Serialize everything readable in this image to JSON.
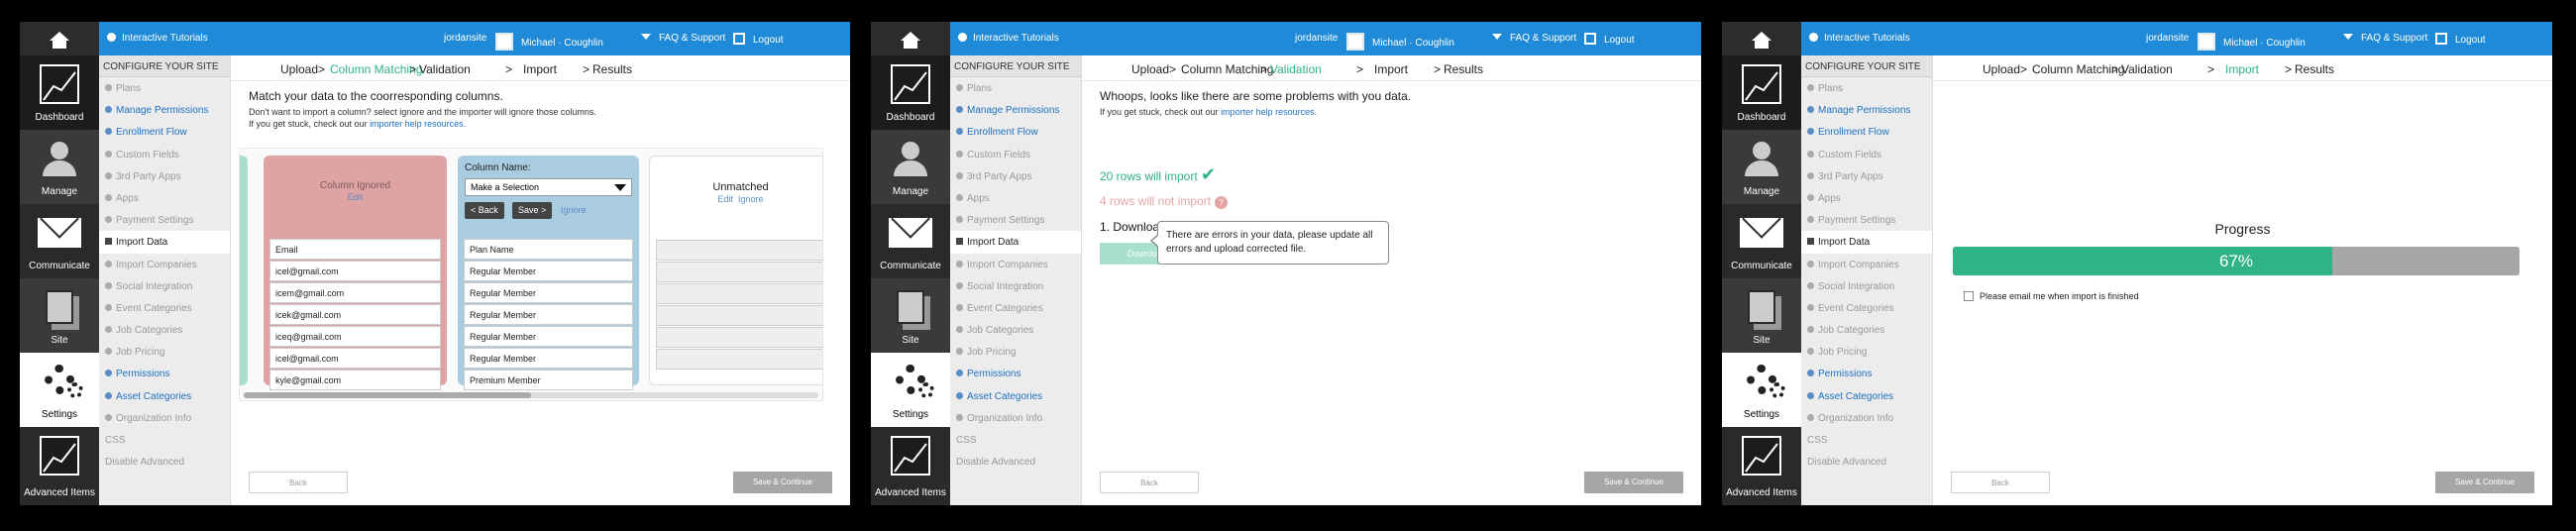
{
  "topbar": {
    "site": "jordansite",
    "user": "Michael · Coughlin",
    "faq": "FAQ & Support",
    "logout": "Logout",
    "info": "Interactive Tutorials"
  },
  "nav": {
    "dashboard": "Dashboard",
    "manage": "Manage",
    "communicate": "Communicate",
    "site": "Site",
    "settings": "Settings",
    "advanced": "Advanced Items"
  },
  "sidebar": {
    "header": "CONFIGURE YOUR SITE",
    "items": [
      "Plans",
      "Manage Permissions",
      "Enrollment Flow",
      "Custom Fields",
      "3rd Party Apps",
      "Apps",
      "Payment Settings",
      "Import Data",
      "Import Companies",
      "Social Integration",
      "Event Categories",
      "Job Categories",
      "Job Pricing",
      "Permissions",
      "Asset Categories",
      "Organization Info",
      "CSS",
      "Disable Advanced"
    ]
  },
  "steps": [
    "Upload",
    "Column Matching",
    "Validation",
    "Import",
    "Results"
  ],
  "sep": ">",
  "footer": {
    "back": "Back",
    "save": "Save & Continue"
  },
  "panel1": {
    "title": "Match your data to the coorresponding columns.",
    "sub1": "Don't want to import a column? select ignore and the importer will ignore those columns.",
    "sub2_pre": "If you get stuck, check out our ",
    "sub2_link": "importer help resources.",
    "ignored_title": "Column Ignored",
    "ignored_edit": "Edit",
    "email_cells": [
      "Email",
      "icel@gmail.com",
      "icem@gmail.com",
      "icek@gmail.com",
      "iceq@gmail.com",
      "icel@gmail.com",
      "kyle@gmail.com"
    ],
    "colname_label": "Column Name:",
    "select_value": "Make a Selection",
    "back_btn": "< Back",
    "save_btn": "Save >",
    "ignore": "Ignore",
    "plan_cells": [
      "Plan Name",
      "Regular Member",
      "Regular Member",
      "Regular Member",
      "Regular Member",
      "Regular Member",
      "Premium Member"
    ],
    "unmatched": "Unmatched",
    "unmatched_edit": "Edit",
    "unmatched_ignore": "Ignore"
  },
  "panel2": {
    "title": "Whoops, looks like there are some problems with you data.",
    "sub_pre": "If you get stuck, check out our ",
    "sub_link": "importer help resources.",
    "ok": "20 rows will import",
    "check": "✔",
    "bad": "4 rows will not import",
    "badge": "?",
    "download": "1. Download",
    "download_btn": "Downlo",
    "tooltip": "There are errors in your data, please update all errors and upload corrected file."
  },
  "panel3": {
    "progress_title": "Progress",
    "progress_label": "67%",
    "progress": 67,
    "email_opt": "Please email me when import is finished"
  },
  "colors": {
    "accent": "#1e8ad8",
    "success": "#30b386",
    "error": "#e6a3a3"
  }
}
